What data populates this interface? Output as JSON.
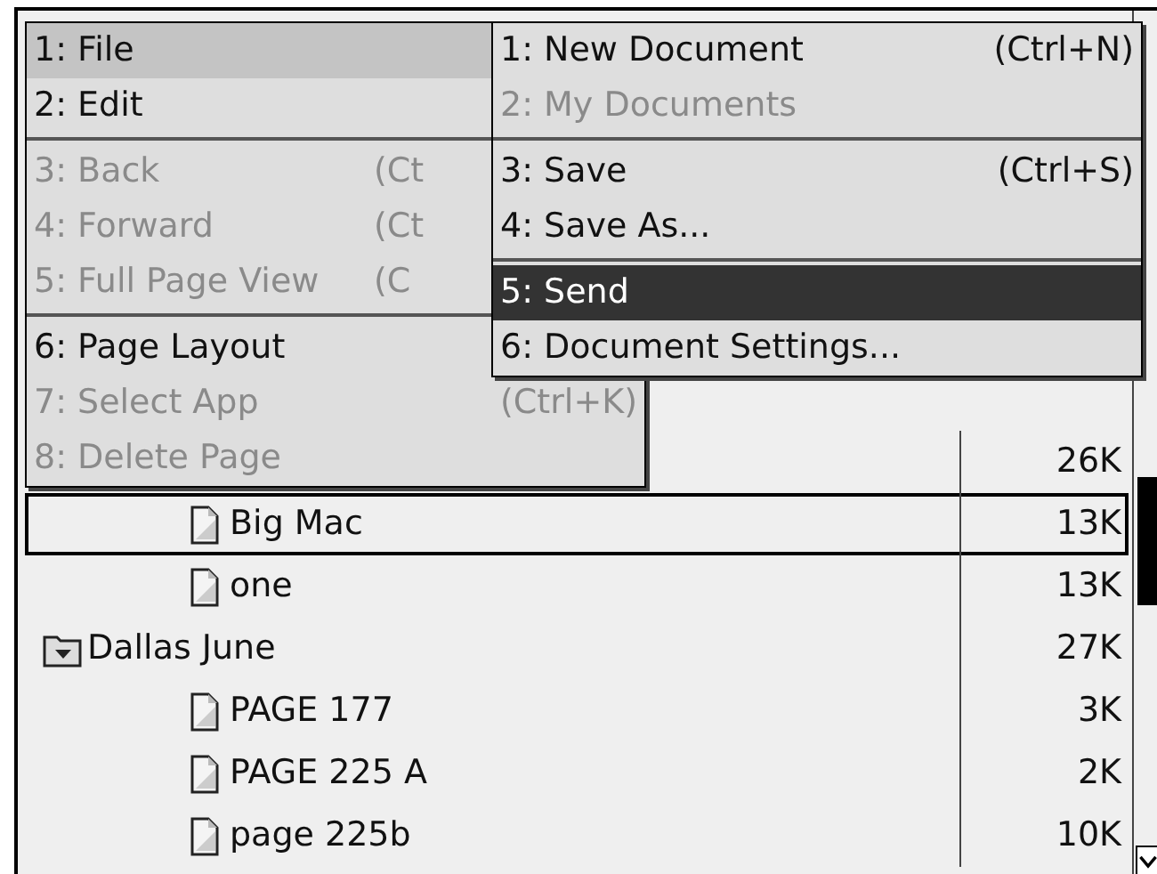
{
  "files": [
    {
      "kind": "folder",
      "size": "26K",
      "expanded": true,
      "children": [
        {
          "kind": "document",
          "name": "Big Mac",
          "size": "13K",
          "selected": true
        },
        {
          "kind": "document",
          "name": "one",
          "size": "13K",
          "selected": false
        }
      ]
    },
    {
      "kind": "folder",
      "name": "Dallas June",
      "size": "27K",
      "expanded": true,
      "children": [
        {
          "kind": "document",
          "name": "PAGE 177",
          "size": "3K",
          "selected": false
        },
        {
          "kind": "document",
          "name": "PAGE 225 A",
          "size": "2K",
          "selected": false
        },
        {
          "kind": "document",
          "name": "page 225b",
          "size": "10K",
          "selected": false
        }
      ]
    }
  ],
  "menu": {
    "focused": false,
    "groups": [
      [
        {
          "label": "1: File",
          "selected": true,
          "disabled": false
        },
        {
          "label": "2: Edit",
          "selected": false,
          "disabled": false
        }
      ],
      [
        {
          "label": "3: Back",
          "shortcut": "(Ct",
          "selected": false,
          "disabled": true
        },
        {
          "label": "4: Forward",
          "shortcut": "(Ct",
          "selected": false,
          "disabled": true
        },
        {
          "label": "5: Full Page View",
          "shortcut": "(C",
          "selected": false,
          "disabled": true
        }
      ],
      [
        {
          "label": "6: Page Layout",
          "selected": false,
          "disabled": false
        },
        {
          "label": "7: Select App",
          "shortcut": "(Ctrl+K)",
          "selected": false,
          "disabled": true
        },
        {
          "label": "8: Delete Page",
          "selected": false,
          "disabled": true
        }
      ]
    ]
  },
  "submenu": {
    "focused": true,
    "groups": [
      [
        {
          "label": "1: New Document",
          "shortcut": "(Ctrl+N)",
          "selected": false,
          "disabled": false
        },
        {
          "label": "2: My Documents",
          "selected": false,
          "disabled": true
        }
      ],
      [
        {
          "label": "3: Save",
          "shortcut": "(Ctrl+S)",
          "selected": false,
          "disabled": false
        },
        {
          "label": "4: Save As...",
          "selected": false,
          "disabled": false
        }
      ],
      [
        {
          "label": "5: Send",
          "selected": true,
          "disabled": false
        },
        {
          "label": "6: Document Settings...",
          "selected": false,
          "disabled": false
        }
      ]
    ]
  }
}
